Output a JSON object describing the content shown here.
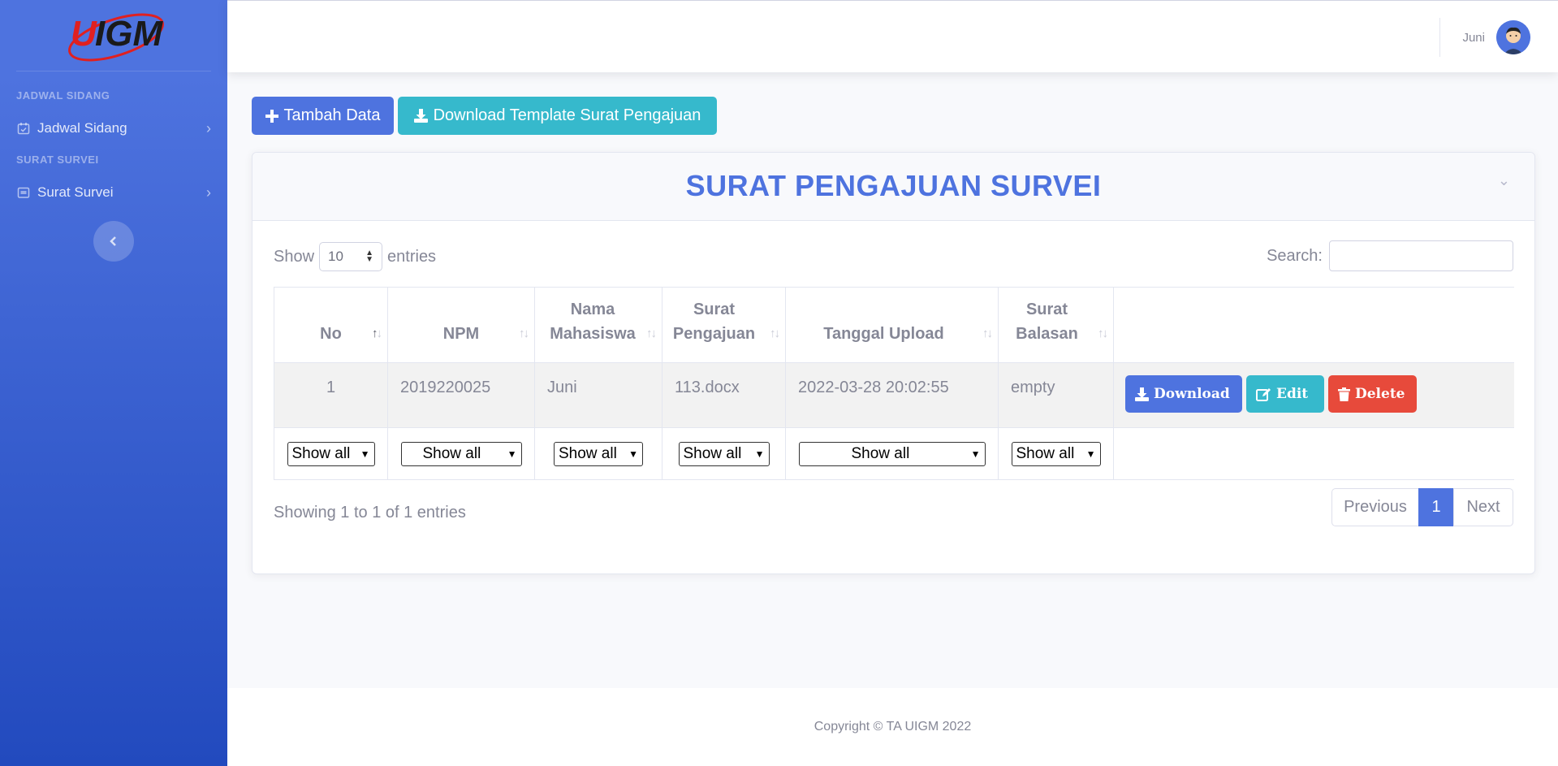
{
  "brand": {
    "logo_text": "UIGM"
  },
  "sidebar": {
    "sections": [
      {
        "heading": "JADWAL SIDANG",
        "item": "Jadwal Sidang"
      },
      {
        "heading": "SURAT SURVEI",
        "item": "Surat Survei"
      }
    ]
  },
  "topbar": {
    "user_name": "Juni"
  },
  "actions": {
    "add_label": "Tambah Data",
    "template_label": "Download Template Surat Pengajuan"
  },
  "card": {
    "title": "SURAT PENGAJUAN SURVEI"
  },
  "table_controls": {
    "show_label": "Show",
    "entries_label": "entries",
    "page_length": "10",
    "search_label": "Search:"
  },
  "table": {
    "columns": [
      "No",
      "NPM",
      "Nama Mahasiswa",
      "Surat Pengajuan",
      "Tanggal Upload",
      "Surat Balasan"
    ],
    "rows": [
      {
        "no": "1",
        "npm": "2019220025",
        "nama": "Juni",
        "surat_pengajuan": "113.docx",
        "tanggal_upload": "2022-03-28 20:02:55",
        "surat_balasan": "empty"
      }
    ],
    "row_actions": {
      "download": "Download",
      "edit": "Edit",
      "delete": "Delete"
    },
    "filter_value": "Show all"
  },
  "pagination": {
    "info": "Showing 1 to 1 of 1 entries",
    "previous": "Previous",
    "current": "1",
    "next": "Next"
  },
  "footer": {
    "copyright": "Copyright © TA UIGM 2022"
  },
  "colors": {
    "primary": "#4e73df",
    "info": "#36b9cc",
    "danger": "#e74a3b",
    "brand_red": "#e02020"
  }
}
